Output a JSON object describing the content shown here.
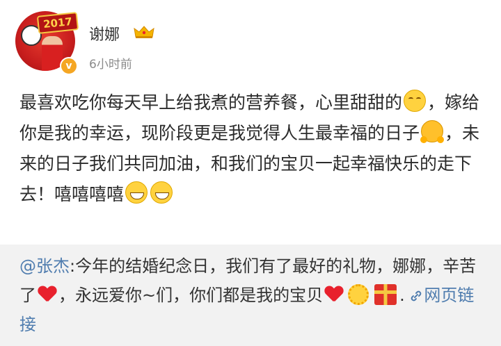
{
  "post": {
    "author": "谢娜",
    "timestamp": "6小时前",
    "avatar_badge_year": "2017",
    "verified_mark": "v",
    "content": {
      "part1": "最喜欢吃你每天早上给我煮的营养餐，心里甜甜的",
      "part2": "，嫁给你是我的幸运，现阶段更是我觉得人生最幸福的日子",
      "part3": "，未来的日子我们共同加油，和我们的宝贝一起幸福快乐的走下去！嘻嘻嘻嘻"
    }
  },
  "repost": {
    "mention": "@张杰",
    "text1": ":今年的结婚纪念日，我们有了最好的礼物，娜娜，辛苦了",
    "text2": "，永远爱你~们，你们都是我的宝贝",
    "text3": ".",
    "link_label": "网页链接"
  },
  "colors": {
    "link": "#507daf",
    "repost_bg": "#f2f2f2",
    "verified_badge": "#f5a623"
  }
}
